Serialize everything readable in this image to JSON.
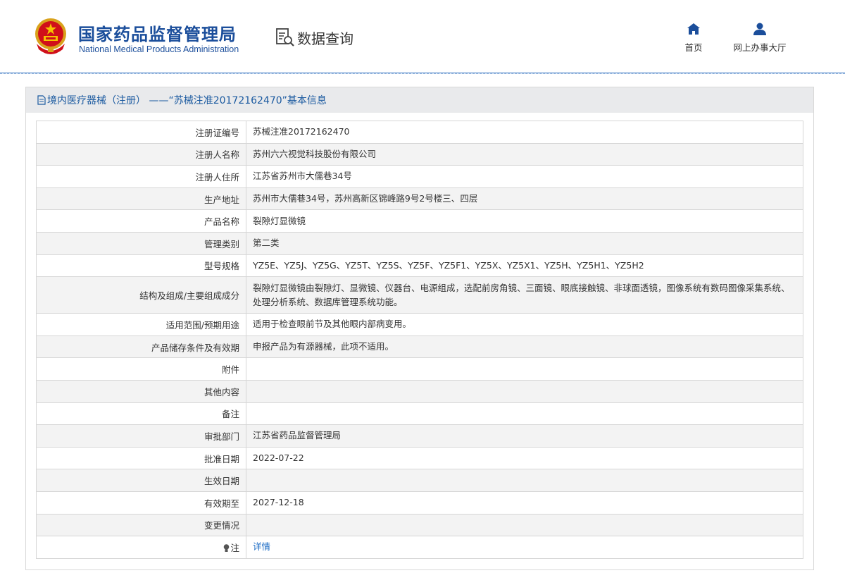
{
  "header": {
    "org_cn": "国家药品监督管理局",
    "org_en": "National Medical Products Administration",
    "query_label": "数据查询",
    "nav": [
      {
        "label": "首页",
        "icon": "home-icon"
      },
      {
        "label": "网上办事大厅",
        "icon": "user-icon"
      }
    ]
  },
  "panel": {
    "title": "境内医疗器械（注册） ——“苏械注准20172162470”基本信息"
  },
  "rows": [
    {
      "key": "注册证编号",
      "value": "苏械注准20172162470"
    },
    {
      "key": "注册人名称",
      "value": "苏州六六视觉科技股份有限公司"
    },
    {
      "key": "注册人住所",
      "value": "江苏省苏州市大儒巷34号"
    },
    {
      "key": "生产地址",
      "value": "苏州市大儒巷34号，苏州高新区锦峰路9号2号楼三、四层"
    },
    {
      "key": "产品名称",
      "value": "裂隙灯显微镜"
    },
    {
      "key": "管理类别",
      "value": "第二类"
    },
    {
      "key": "型号规格",
      "value": "YZ5E、YZ5J、YZ5G、YZ5T、YZ5S、YZ5F、YZ5F1、YZ5X、YZ5X1、YZ5H、YZ5H1、YZ5H2"
    },
    {
      "key": "结构及组成/主要组成成分",
      "value": "裂隙灯显微镜由裂隙灯、显微镜、仪器台、电源组成，选配前房角镜、三面镜、眼底接触镜、非球面透镜，图像系统有数码图像采集系统、处理分析系统、数据库管理系统功能。"
    },
    {
      "key": "适用范围/预期用途",
      "value": "适用于检查眼前节及其他眼内部病变用。"
    },
    {
      "key": "产品储存条件及有效期",
      "value": "申报产品为有源器械，此项不适用。"
    },
    {
      "key": "附件",
      "value": ""
    },
    {
      "key": "其他内容",
      "value": ""
    },
    {
      "key": "备注",
      "value": ""
    },
    {
      "key": "审批部门",
      "value": "江苏省药品监督管理局"
    },
    {
      "key": "批准日期",
      "value": "2022-07-22"
    },
    {
      "key": "生效日期",
      "value": ""
    },
    {
      "key": "有效期至",
      "value": "2027-12-18"
    },
    {
      "key": "变更情况",
      "value": ""
    },
    {
      "key": "注",
      "value": "详情"
    }
  ],
  "colors": {
    "brand": "#1b4e9b",
    "link": "#1b6bc4"
  }
}
